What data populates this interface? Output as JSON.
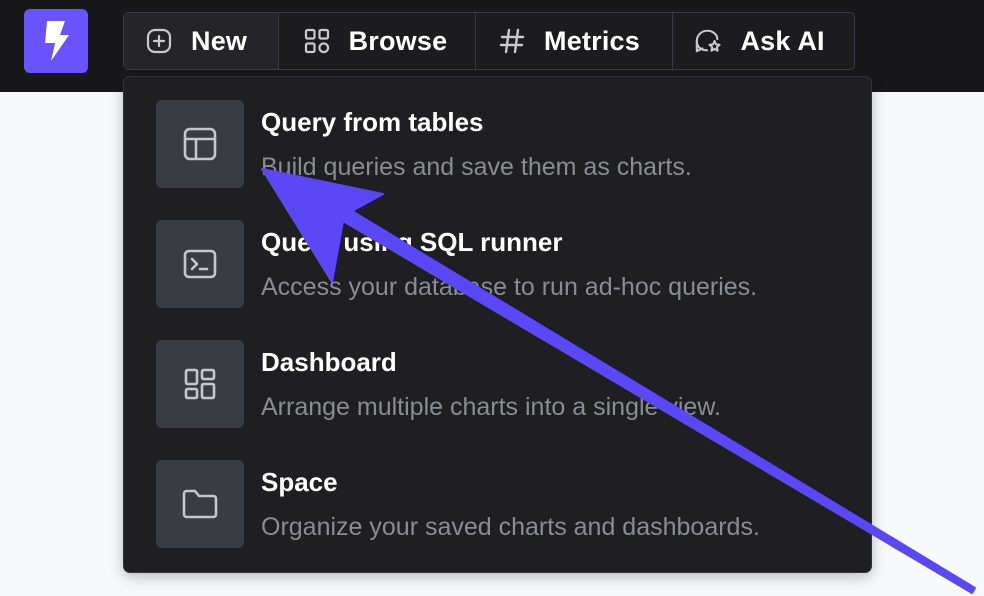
{
  "nav": {
    "new_label": "New",
    "browse_label": "Browse",
    "metrics_label": "Metrics",
    "ask_ai_label": "Ask AI"
  },
  "menu": {
    "items": [
      {
        "title": "Query from tables",
        "description": "Build queries and save them as charts.",
        "icon": "table-icon"
      },
      {
        "title": "Query using SQL runner",
        "description": "Access your database to run ad-hoc queries.",
        "icon": "terminal-icon"
      },
      {
        "title": "Dashboard",
        "description": "Arrange multiple charts into a single view.",
        "icon": "dashboard-icon"
      },
      {
        "title": "Space",
        "description": "Organize your saved charts and dashboards.",
        "icon": "folder-icon"
      }
    ]
  },
  "colors": {
    "brand": "#6b52ff",
    "annotation_arrow": "#5b47f5",
    "topbar_bg": "#18181b",
    "menu_bg": "#1f1f22",
    "page_bg": "#f8f9fa"
  }
}
